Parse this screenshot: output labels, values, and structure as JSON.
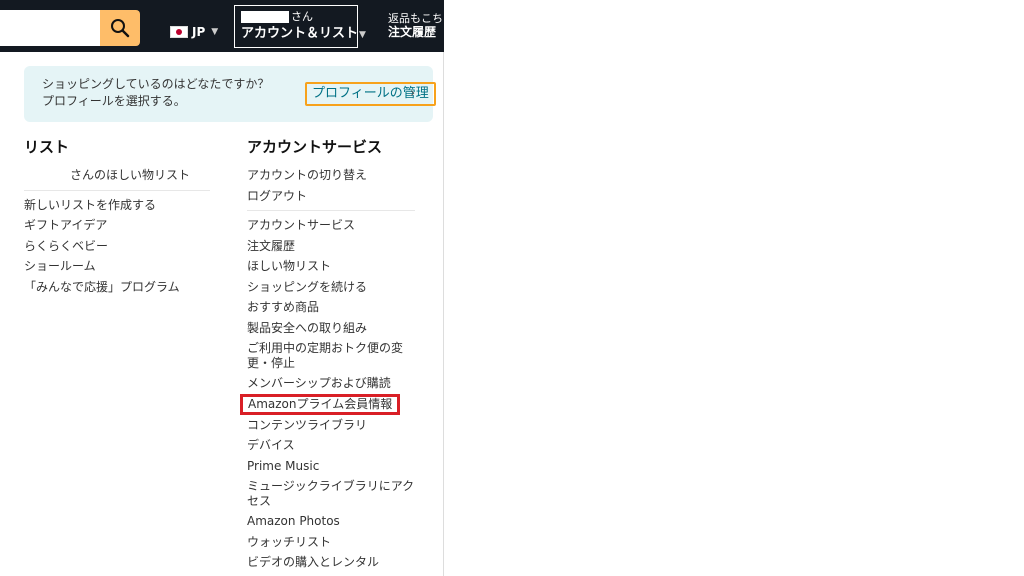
{
  "header": {
    "search": {
      "value": "",
      "placeholder": ""
    },
    "language": {
      "code": "JP"
    },
    "account": {
      "greeting": "さん",
      "label": "アカウント＆リスト"
    },
    "returns": {
      "line1": "返品もこち",
      "line2": "注文履歴"
    }
  },
  "panel": {
    "profile": {
      "prompt": "ショッピングしているのはどなたですか？プロフィールを選択する。",
      "manage_link": "プロフィールの管理"
    },
    "lists": {
      "heading": "リスト",
      "wishlist": "さんのほしい物リスト",
      "items": [
        "新しいリストを作成する",
        "ギフトアイデア",
        "らくらくベビー",
        "ショールーム",
        "「みんなで応援」プログラム"
      ]
    },
    "account_services": {
      "heading": "アカウントサービス",
      "top_items": [
        "アカウントの切り替え",
        "ログアウト"
      ],
      "items": [
        "アカウントサービス",
        "注文履歴",
        "ほしい物リスト",
        "ショッピングを続ける",
        "おすすめ商品",
        "製品安全への取り組み",
        "ご利用中の定期おトク便の変更・停止",
        "メンバーシップおよび購読",
        "Amazonプライム会員情報",
        "コンテンツライブラリ",
        "デバイス",
        "Prime Music",
        "ミュージックライブラリにアクセス",
        "Amazon Photos",
        "ウォッチリスト",
        "ビデオの購入とレンタル"
      ]
    }
  },
  "colors": {
    "nav_bg": "#131921",
    "search_button": "#febd69",
    "profile_bg": "#e5f4f6",
    "profile_link_border": "#f7a21c",
    "link_teal": "#007185",
    "highlight_red": "#d91f26"
  }
}
